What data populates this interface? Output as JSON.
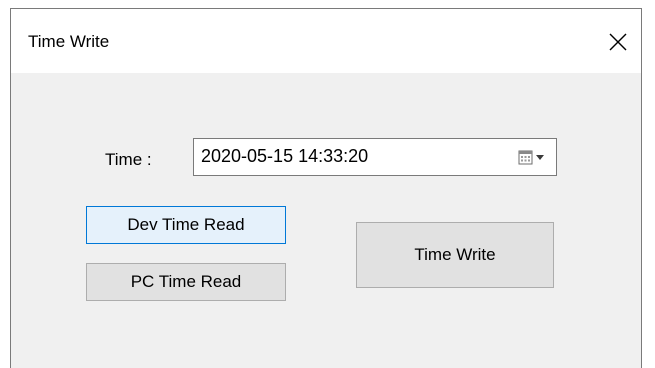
{
  "window": {
    "title": "Time Write",
    "close_glyph": "close-icon"
  },
  "form": {
    "time_label": "Time :",
    "time_value": "2020-05-15 14:33:20",
    "calendar_icon": "calendar-icon",
    "dropdown_icon": "chevron-down-icon"
  },
  "buttons": {
    "dev_time_read": "Dev Time Read",
    "pc_time_read": "PC Time Read",
    "time_write": "Time Write"
  },
  "colors": {
    "focused_button_border": "#0078d7",
    "focused_button_bg": "#e5f1fb",
    "button_bg": "#e1e1e1",
    "dialog_bg": "#f0f0f0"
  }
}
